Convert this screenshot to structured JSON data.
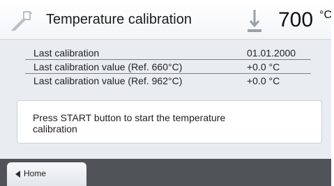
{
  "header": {
    "title": "Temperature calibration",
    "temperature_value": "700",
    "temperature_unit": "°C"
  },
  "calibration_info": [
    {
      "label": "Last calibration",
      "value": "01.01.2000"
    },
    {
      "label": "Last calibration value (Ref. 660°C)",
      "value": "+0.0 °C"
    },
    {
      "label": "Last calibration value (Ref. 962°C)",
      "value": "+0.0 °C"
    }
  ],
  "message": {
    "text": "Press START button to start the temperature calibration"
  },
  "footer": {
    "home_label": "Home"
  },
  "icons": {
    "header": "calibration-probe-icon",
    "temperature": "furnace-temperature-icon",
    "home": "left-arrow-icon"
  },
  "colors": {
    "background": "#e9edf2",
    "footer": "#505459",
    "text": "#1f1f1f"
  }
}
